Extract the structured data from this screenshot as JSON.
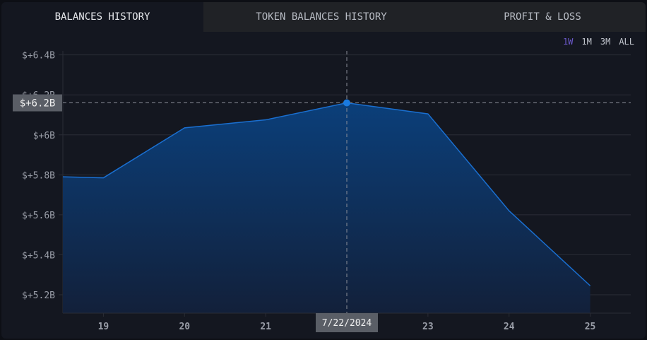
{
  "tabs": [
    {
      "label": "BALANCES HISTORY",
      "active": true
    },
    {
      "label": "TOKEN BALANCES HISTORY"
    },
    {
      "label": "PROFIT & LOSS"
    }
  ],
  "ranges": [
    "1W",
    "1M",
    "3M",
    "ALL"
  ],
  "selected_range": "1W",
  "crosshair": {
    "x_label": "7/22/2024",
    "y_label": "$+6.2B"
  },
  "colors": {
    "line": "#1a6fd0",
    "accent": "#6e5bd0",
    "point": "#1a7ae0"
  },
  "chart_data": {
    "type": "area",
    "x": [
      18.5,
      19,
      20,
      21,
      22,
      23,
      24,
      25
    ],
    "values": [
      5.79,
      5.785,
      6.035,
      6.075,
      6.16,
      6.105,
      5.62,
      5.245
    ],
    "unit": "B USD",
    "xticks": [
      19,
      20,
      21,
      22,
      23,
      24,
      25
    ],
    "xtick_labels": [
      "19",
      "20",
      "21",
      "22",
      "23",
      "24",
      "25"
    ],
    "yticks": [
      5.2,
      5.4,
      5.6,
      5.8,
      6.0,
      6.2,
      6.4
    ],
    "ytick_labels": [
      "$+5.2B",
      "$+5.4B",
      "$+5.6B",
      "$+5.8B",
      "$+6B",
      "$+6.2B",
      "$+6.4B"
    ],
    "xlim": [
      18.5,
      25.5
    ],
    "ylim": [
      5.108,
      6.42
    ],
    "grid": true,
    "highlight_index": 4
  }
}
